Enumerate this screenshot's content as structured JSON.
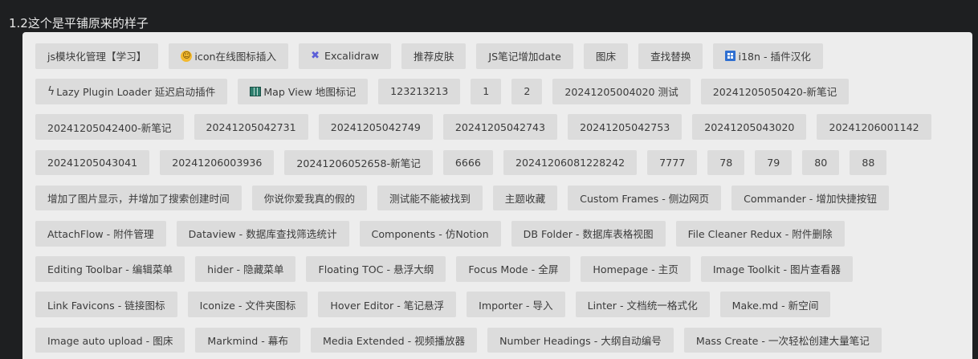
{
  "title": "1.2这个是平铺原来的样子",
  "tags": [
    {
      "label": "js模块化管理【学习】"
    },
    {
      "label": "icon在线图标插入",
      "icon": "emoji-icon"
    },
    {
      "label": "Excalidraw",
      "icon": "excalidraw-icon"
    },
    {
      "label": "推荐皮肤"
    },
    {
      "label": "JS笔记增加date"
    },
    {
      "label": "图床"
    },
    {
      "label": "查找替换"
    },
    {
      "label": "i18n - 插件汉化",
      "icon": "grid-icon"
    },
    {
      "label": "Lazy Plugin Loader 延迟启动插件",
      "icon": "lightning-icon"
    },
    {
      "label": "Map View 地图标记",
      "icon": "map-icon"
    },
    {
      "label": "123213213"
    },
    {
      "label": "1"
    },
    {
      "label": "2"
    },
    {
      "label": "20241205004020 测试"
    },
    {
      "label": "20241205050420-新笔记"
    },
    {
      "label": "20241205042400-新笔记"
    },
    {
      "label": "20241205042731"
    },
    {
      "label": "20241205042749"
    },
    {
      "label": "20241205042743"
    },
    {
      "label": "20241205042753"
    },
    {
      "label": "20241205043020"
    },
    {
      "label": "20241206001142"
    },
    {
      "label": "20241205043041"
    },
    {
      "label": "20241206003936"
    },
    {
      "label": "20241206052658-新笔记"
    },
    {
      "label": "6666"
    },
    {
      "label": "20241206081228242"
    },
    {
      "label": "7777"
    },
    {
      "label": "78"
    },
    {
      "label": "79"
    },
    {
      "label": "80"
    },
    {
      "label": "88"
    },
    {
      "label": "增加了图片显示，并增加了搜索创建时间"
    },
    {
      "label": "你说你爱我真的假的"
    },
    {
      "label": "测试能不能被找到"
    },
    {
      "label": "主题收藏"
    },
    {
      "label": "Custom Frames - 侧边网页"
    },
    {
      "label": "Commander - 增加快捷按钮"
    },
    {
      "label": "AttachFlow - 附件管理"
    },
    {
      "label": "Dataview - 数据库查找筛选统计"
    },
    {
      "label": "Components - 仿Notion"
    },
    {
      "label": "DB Folder - 数据库表格视图"
    },
    {
      "label": "File Cleaner Redux - 附件删除"
    },
    {
      "label": "Editing Toolbar - 编辑菜单"
    },
    {
      "label": "hider - 隐藏菜单"
    },
    {
      "label": "Floating TOC - 悬浮大纲"
    },
    {
      "label": "Focus Mode - 全屏"
    },
    {
      "label": "Homepage - 主页"
    },
    {
      "label": "Image Toolkit - 图片查看器"
    },
    {
      "label": "Link Favicons - 链接图标"
    },
    {
      "label": "Iconize - 文件夹图标"
    },
    {
      "label": "Hover Editor - 笔记悬浮"
    },
    {
      "label": "Importer - 导入"
    },
    {
      "label": "Linter - 文档统一格式化"
    },
    {
      "label": "Make.md - 新空间"
    },
    {
      "label": "Image auto upload - 图床"
    },
    {
      "label": "Markmind - 幕布"
    },
    {
      "label": "Media Extended - 视频播放器"
    },
    {
      "label": "Number Headings - 大纲自动编号"
    },
    {
      "label": "Mass Create - 一次轻松创建大量笔记"
    }
  ]
}
